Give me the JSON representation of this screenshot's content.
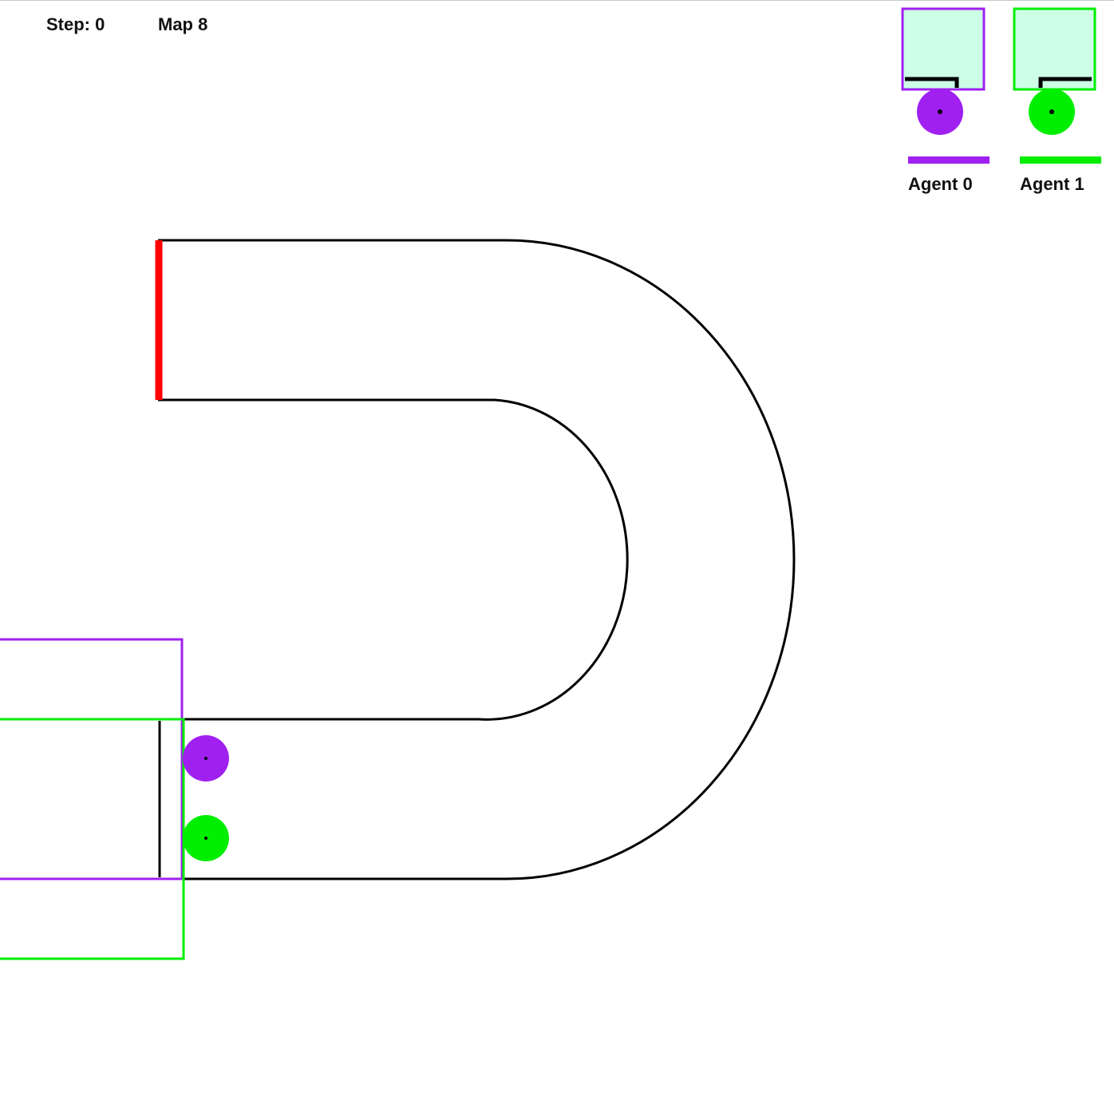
{
  "hud": {
    "step_label": "Step:",
    "step_value": "0",
    "map_label": "Map 8"
  },
  "agents": [
    {
      "label": "Agent 0",
      "color": "#a020f0"
    },
    {
      "label": "Agent 1",
      "color": "#00ee00"
    }
  ],
  "colors": {
    "track_border": "#000000",
    "goal_line": "#ff0000",
    "minimap_fill": "#ccffe6",
    "background": "#ffffff"
  }
}
